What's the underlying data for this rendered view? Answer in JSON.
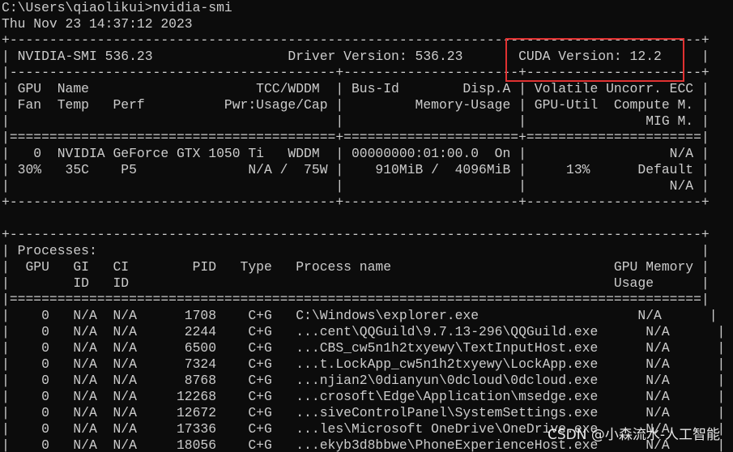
{
  "terminal": {
    "lines": [
      "C:\\Users\\qiaolikui>nvidia-smi",
      "Thu Nov 23 14:37:12 2023",
      "+---------------------------------------------------------------------------------------+",
      "| NVIDIA-SMI 536.23                 Driver Version: 536.23       CUDA Version: 12.2     |",
      "|-----------------------------------------+----------------------+----------------------+",
      "| GPU  Name                     TCC/WDDM  | Bus-Id        Disp.A | Volatile Uncorr. ECC |",
      "| Fan  Temp   Perf          Pwr:Usage/Cap |         Memory-Usage | GPU-Util  Compute M. |",
      "|                                         |                      |               MIG M. |",
      "|=========================================+======================+======================|",
      "|   0  NVIDIA GeForce GTX 1050 Ti   WDDM  | 00000000:01:00.0  On |                  N/A |",
      "| 30%   35C    P5              N/A /  75W |    910MiB /  4096MiB |     13%      Default |",
      "|                                         |                      |                  N/A |",
      "+-----------------------------------------+----------------------+----------------------+",
      "",
      "+---------------------------------------------------------------------------------------+",
      "| Processes:                                                                            |",
      "|  GPU   GI   CI        PID   Type   Process name                            GPU Memory |",
      "|        ID   ID                                                             Usage      |",
      "|=======================================================================================|",
      "|    0   N/A  N/A      1708    C+G   C:\\Windows\\explorer.exe                    N/A      |",
      "|    0   N/A  N/A      2244    C+G   ...cent\\QQGuild\\9.7.13-296\\QQGuild.exe      N/A      |",
      "|    0   N/A  N/A      6500    C+G   ...CBS_cw5n1h2txyewy\\TextInputHost.exe      N/A      |",
      "|    0   N/A  N/A      7324    C+G   ...t.LockApp_cw5n1h2txyewy\\LockApp.exe      N/A      |",
      "|    0   N/A  N/A      8768    C+G   ...njian2\\0dianyun\\0dcloud\\0dcloud.exe      N/A      |",
      "|    0   N/A  N/A     12268    C+G   ...crosoft\\Edge\\Application\\msedge.exe      N/A      |",
      "|    0   N/A  N/A     12672    C+G   ...siveControlPanel\\SystemSettings.exe      N/A      |",
      "|    0   N/A  N/A     17336    C+G   ...les\\Microsoft OneDrive\\OneDrive.exe      N/A      |",
      "|    0   N/A  N/A     18056    C+G   ...ekyb3d8bbwe\\PhoneExperienceHost.exe      N/A      |"
    ]
  },
  "watermark": "CSDN @小森流水-人工智能",
  "colors": {
    "background": "#0c0c0c",
    "text": "#cccccc",
    "highlight": "#e03131"
  }
}
